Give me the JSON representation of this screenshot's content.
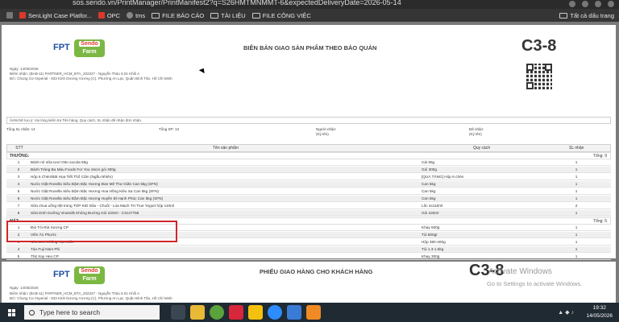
{
  "browser": {
    "url": "sos.sendo.vn/PrintManager/PrintManifest2?q=S26HMTMNMMT-6&expectedDeliveryDate=2026-05-14",
    "bookmarks": [
      "SenLight Case Platfor...",
      "OPC",
      "tms",
      "FILE BÁO CÁO",
      "TÀI LIỆU",
      "FILE CÔNG VIỆC"
    ],
    "all_bookmarks": "Tất cả dấu trang"
  },
  "document": {
    "logo": {
      "brand": "FPT",
      "line1": "Sendo",
      "line2": "Farm"
    },
    "title": "BIÊN BẢN GIAO SẢN PHẨM THEO BẢO QUẢN",
    "code": "C3-8",
    "meta": {
      "date": "Ngày: 14/05/2026",
      "pickup": "Điểm nhận: (BAB-11) PARTNER_HCM_BTA_202327 - Nguyễn Thảo 6.01 Khối A",
      "address": "Đ/c: Chung Cư Imperial - 833 Kinh Dương Vương (C), Phường An Lạc, Quận Bình Tân, Hồ Chí Minh"
    },
    "note": "Ảnh/chữ lưu ý: Vui lòng kiểm tra Tên hàng, Quy cách, SL nhận để nhận đơn nhận.",
    "summary": {
      "total_orders": "Tổng SL nhận: 14",
      "total_sp": "Tổng SP: 13",
      "receiver": "Người nhận:",
      "receiver_sign": "(Ký tên)",
      "deliverer": "Đã nhận:",
      "deliverer_sign": "(Ký tên)"
    },
    "columns": {
      "stt": "STT",
      "name": "Tên sản phẩm",
      "spec": "Quy cách",
      "qty": "SL nhận"
    },
    "groups": [
      {
        "label": "THƯỜNG:",
        "total": "Tổng: 9",
        "rows": [
          {
            "stt": "1",
            "name": "Bánh mì sữa tươi Otto socola 55g",
            "spec": "Cái 55g",
            "qty": "1"
          },
          {
            "stt": "2",
            "name": "Bánh Tráng Ba Màu Foods For You 16cm gói 300g",
            "spec": "Gói 300g",
            "qty": "1"
          },
          {
            "stt": "3",
            "name": "Hộp 6 Chén/Bát Họa Tiết Thổ Cẩm (Ngẫu Nhiên)",
            "spec": "[QUÀ TẶNG] Hộp 6 chén",
            "qty": "1"
          },
          {
            "stt": "4",
            "name": "Nước Giặt Rosella Siêu Đậm Đặc Hương Đan Mê Thư Giãn Can 5kg (SFN)",
            "spec": "Can 5kg",
            "qty": "1"
          },
          {
            "stt": "5",
            "name": "Nước Giặt Rosella Siêu Đậm Đặc Hương Hoa Hồng Kiêu Sa Can 5kg (SFN)",
            "spec": "Can 5kg",
            "qty": "1"
          },
          {
            "stt": "6",
            "name": "Nước Giặt Rosella Siêu Đậm Đặc Hương Huyền Bí Hạnh Phúc Can 5kg (SFN)",
            "spec": "Can 5kg",
            "qty": "1"
          },
          {
            "stt": "7",
            "name": "Sữa chua uống tiệt trùng TOP KID Dâu - Chuối - Lúa Mạch TH True Yogurt hộp 110ml",
            "spec": "Lốc 4x110ml",
            "qty": "2"
          },
          {
            "stt": "8",
            "name": "Sữa Dinh Dưỡng Vinamilk Không Đường Gói 220ml - C3147758",
            "spec": "Gói 220ml",
            "qty": "1"
          }
        ]
      },
      {
        "label": "MÁT:",
        "total": "Tổng: 5",
        "rows": [
          {
            "stt": "1",
            "name": "Đùi Tỏi Rút Xương CP",
            "spec": "Khay 500g",
            "qty": "1"
          },
          {
            "stt": "2",
            "name": "Viên Ăn Phước",
            "spec": "Túi 500gr",
            "qty": "1"
          },
          {
            "stt": "3",
            "name": "Nho Đen Không Hạt Chile",
            "spec": "Hộp 380-400g",
            "qty": "1"
          },
          {
            "stt": "4",
            "name": "Táo Fuji Nam Phi",
            "spec": "Túi 1.3-1.5kg",
            "qty": "1"
          },
          {
            "stt": "5",
            "name": "Thịt Xay Heo CP",
            "spec": "Khay 300g",
            "qty": "1"
          }
        ]
      }
    ],
    "second_title": "PHIẾU GIAO HÀNG CHO KHÁCH HÀNG",
    "second_code": "C3-8",
    "second_date": "Ngày: 14/05/2026",
    "second_pickup": "Điểm nhận: (BAB-11) PARTNER_HCM_BTA_202327 - Nguyễn Thảo 6.01 Khối A",
    "second_address": "Đ/c: Chung Cư Imperial - 833 Kinh Dương Vương (C), Phường An Lạc, Quận Bình Tân, Hồ Chí Minh"
  },
  "watermark": {
    "line1": "Activate Windows",
    "line2": "Go to Settings to activate Windows."
  },
  "taskbar": {
    "search_placeholder": "Type here to search",
    "time": "19:32",
    "date": "14/05/2026",
    "badge": "21"
  }
}
